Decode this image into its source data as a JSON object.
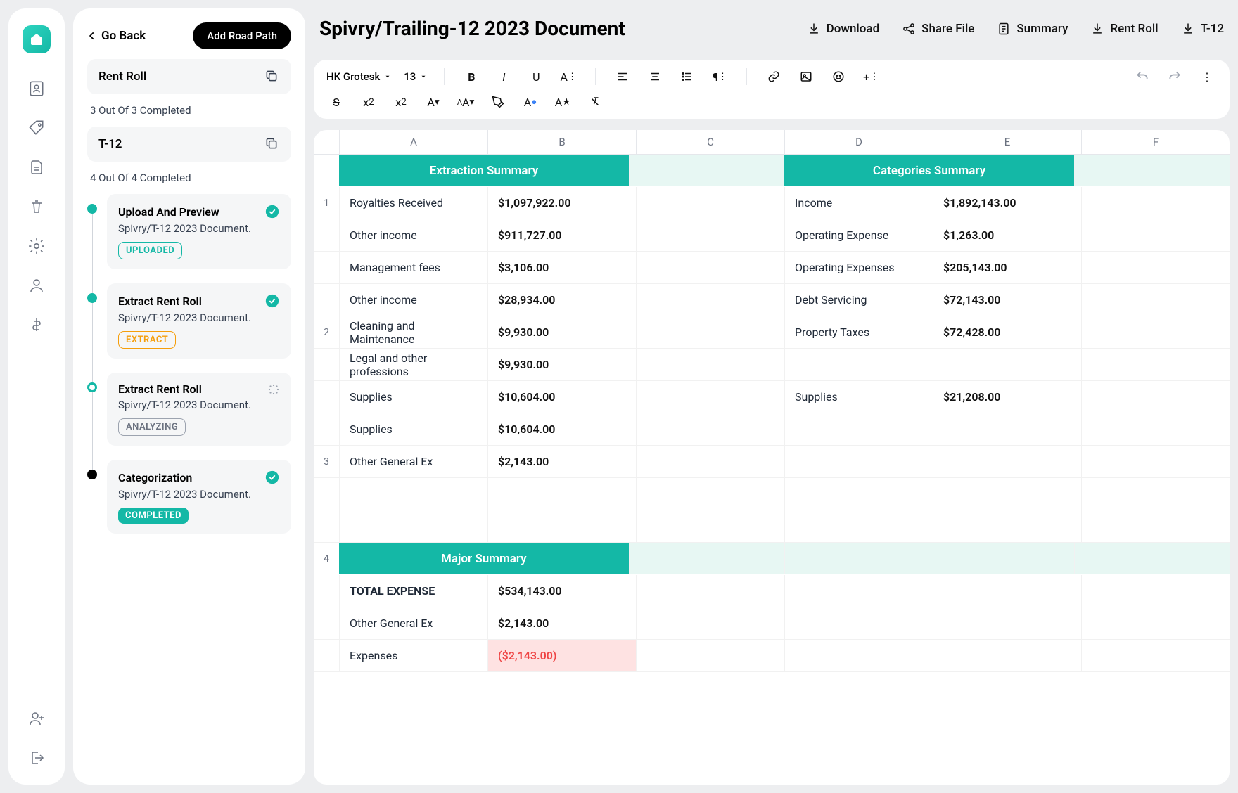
{
  "goback": "Go Back",
  "add_road_path": "Add Road Path",
  "sections": [
    {
      "title": "Rent Roll",
      "completed": "3 Out Of 3 Completed"
    },
    {
      "title": "T-12",
      "completed": "4 Out Of 4 Completed"
    }
  ],
  "steps": [
    {
      "title": "Upload And Preview",
      "subtitle": "Spivry/T-12 2023 Document.",
      "badge": "UPLOADED",
      "badge_cls": "uploaded",
      "dot": "solid-teal",
      "status": "check"
    },
    {
      "title": "Extract Rent Roll",
      "subtitle": "Spivry/T-12 2023 Document.",
      "badge": "EXTRACT",
      "badge_cls": "extract",
      "dot": "solid-teal",
      "status": "check"
    },
    {
      "title": "Extract Rent Roll",
      "subtitle": "Spivry/T-12 2023 Document.",
      "badge": "ANALYZING",
      "badge_cls": "analyzing",
      "dot": "hollow-teal",
      "status": "loading"
    },
    {
      "title": "Categorization",
      "subtitle": "Spivry/T-12 2023 Document.",
      "badge": "COMPLETED",
      "badge_cls": "completed",
      "dot": "solid-black",
      "status": "check"
    }
  ],
  "doc_title": "Spivry/Trailing-12 2023 Document",
  "top_actions": {
    "download": "Download",
    "share": "Share File",
    "summary": "Summary",
    "rentroll": "Rent Roll",
    "t12": "T-12"
  },
  "toolbar": {
    "font": "HK Grotesk",
    "size": "13"
  },
  "columns": [
    "A",
    "B",
    "C",
    "D",
    "E",
    "F"
  ],
  "hdr_extraction": "Extraction Summary",
  "hdr_categories": "Categories Summary",
  "hdr_major": "Major Summary",
  "rows_1": [
    {
      "l": "Royalties Received",
      "v": "$1,097,922.00",
      "c": "Income",
      "cv": "$1,892,143.00"
    },
    {
      "l": "Other income",
      "v": "$911,727.00",
      "c": "Operating Expense",
      "cv": "$1,263.00"
    },
    {
      "l": "Management fees",
      "v": "$3,106.00",
      "c": "Operating Expenses",
      "cv": "$205,143.00"
    },
    {
      "l": "Other income",
      "v": "$28,934.00",
      "c": "Debt Servicing",
      "cv": "$72,143.00"
    },
    {
      "l": "Cleaning and Maintenance",
      "v": "$9,930.00",
      "c": "Property Taxes",
      "cv": "$72,428.00"
    },
    {
      "l": "Legal and other professions",
      "v": "$9,930.00",
      "c": "",
      "cv": ""
    },
    {
      "l": "Supplies",
      "v": "$10,604.00",
      "c": "Supplies",
      "cv": "$21,208.00"
    },
    {
      "l": "Supplies",
      "v": "$10,604.00",
      "c": "",
      "cv": ""
    },
    {
      "l": "Other General Ex",
      "v": "$2,143.00",
      "c": "",
      "cv": ""
    }
  ],
  "rows_major": [
    {
      "l": "TOTAL EXPENSE",
      "v": "$534,143.00",
      "bold": true
    },
    {
      "l": "Other General Ex",
      "v": "$2,143.00"
    },
    {
      "l": "Expenses",
      "v": "($2,143.00)",
      "neg": true
    }
  ]
}
